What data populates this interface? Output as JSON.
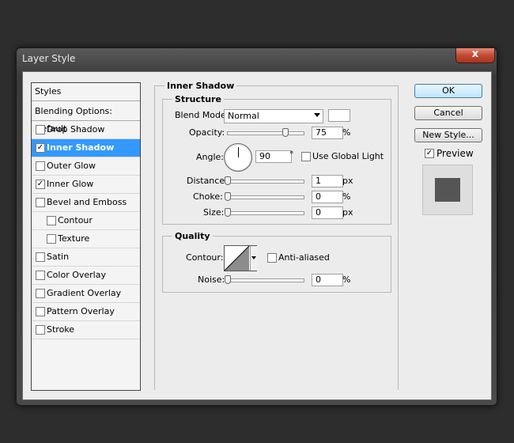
{
  "window": {
    "title": "Layer Style",
    "close_label": "x"
  },
  "sidebar": {
    "header": "Styles",
    "blending": "Blending Options: Default",
    "items": [
      {
        "label": "Drop Shadow",
        "checked": false,
        "mark": ""
      },
      {
        "label": "Inner Shadow",
        "checked": true,
        "mark": "✓",
        "selected": true
      },
      {
        "label": "Outer Glow",
        "checked": false,
        "mark": ""
      },
      {
        "label": "Inner Glow",
        "checked": true,
        "mark": "✓"
      },
      {
        "label": "Bevel and Emboss",
        "checked": false,
        "mark": ""
      },
      {
        "label": "Contour",
        "checked": false,
        "mark": "",
        "indent": true
      },
      {
        "label": "Texture",
        "checked": false,
        "mark": "",
        "indent": true
      },
      {
        "label": "Satin",
        "checked": false,
        "mark": ""
      },
      {
        "label": "Color Overlay",
        "checked": false,
        "mark": ""
      },
      {
        "label": "Gradient Overlay",
        "checked": false,
        "mark": ""
      },
      {
        "label": "Pattern Overlay",
        "checked": false,
        "mark": ""
      },
      {
        "label": "Stroke",
        "checked": false,
        "mark": ""
      }
    ]
  },
  "panel": {
    "title": "Inner Shadow",
    "structure": {
      "title": "Structure",
      "blend_mode_label": "Blend Mode:",
      "blend_mode_value": "Normal",
      "shadow_color": "#ffffff",
      "opacity_label": "Opacity:",
      "opacity_value": "75",
      "opacity_unit": "%",
      "angle_label": "Angle:",
      "angle_value": "90",
      "angle_unit": "°",
      "global_light_label": "Use Global Light",
      "global_light_checked": false,
      "distance_label": "Distance:",
      "distance_value": "1",
      "distance_unit": "px",
      "choke_label": "Choke:",
      "choke_value": "0",
      "choke_unit": "%",
      "size_label": "Size:",
      "size_value": "0",
      "size_unit": "px"
    },
    "quality": {
      "title": "Quality",
      "contour_label": "Contour:",
      "anti_aliased_label": "Anti-aliased",
      "anti_aliased_checked": false,
      "noise_label": "Noise:",
      "noise_value": "0",
      "noise_unit": "%"
    }
  },
  "buttons": {
    "ok": "OK",
    "cancel": "Cancel",
    "new_style": "New Style...",
    "preview_label": "Preview",
    "preview_checked": true,
    "preview_mark": "✓"
  },
  "colors": {
    "selection": "#3399ff",
    "close_button": "#c44a33",
    "preview_swatch": "#555555"
  }
}
